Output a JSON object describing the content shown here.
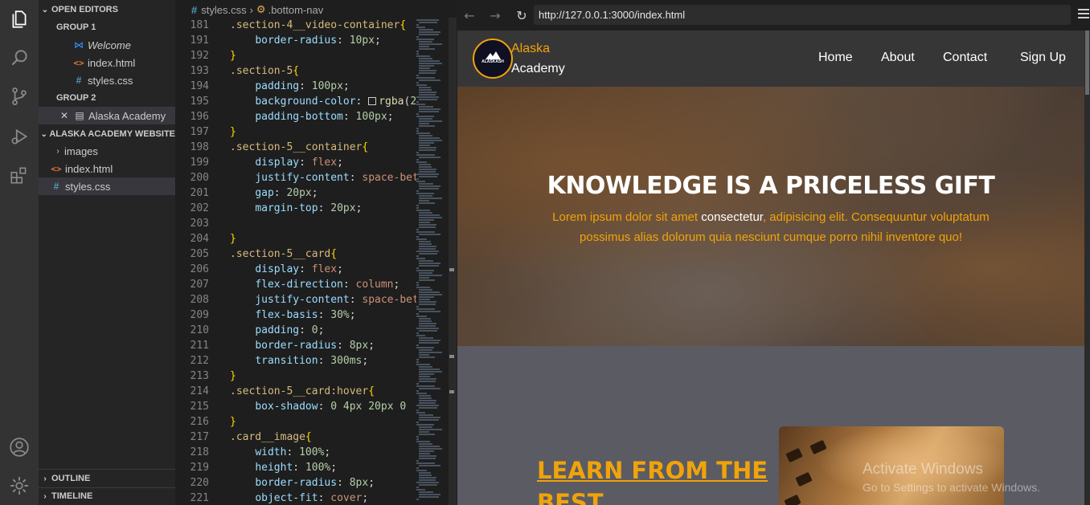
{
  "explorer": {
    "open_editors_title": "OPEN EDITORS",
    "group1_label": "GROUP 1",
    "group1_files": [
      "Welcome",
      "index.html",
      "styles.css"
    ],
    "group2_label": "GROUP 2",
    "group2_files": [
      "Alaska Academy"
    ],
    "workspace_title": "ALASKA ACADEMY WEBSITE",
    "tree": [
      "images",
      "index.html",
      "styles.css"
    ],
    "outline_label": "OUTLINE",
    "timeline_label": "TIMELINE"
  },
  "breadcrumb": {
    "file": "styles.css",
    "symbol": ".bottom-nav"
  },
  "code_lines": [
    {
      "n": "181",
      "t": ".section-4__video-container{"
    },
    {
      "n": "191",
      "t": "    border-radius: 10px;"
    },
    {
      "n": "192",
      "t": "}"
    },
    {
      "n": "193",
      "t": ".section-5{"
    },
    {
      "n": "194",
      "t": "    padding: 100px;"
    },
    {
      "n": "195",
      "t": "    background-color: rgba(2"
    },
    {
      "n": "196",
      "t": "    padding-bottom: 100px;"
    },
    {
      "n": "197",
      "t": "}"
    },
    {
      "n": "198",
      "t": ".section-5__container{"
    },
    {
      "n": "199",
      "t": "    display: flex;"
    },
    {
      "n": "200",
      "t": "    justify-content: space-bet"
    },
    {
      "n": "201",
      "t": "    gap: 20px;"
    },
    {
      "n": "202",
      "t": "    margin-top: 20px;"
    },
    {
      "n": "203",
      "t": ""
    },
    {
      "n": "204",
      "t": "}"
    },
    {
      "n": "205",
      "t": ".section-5__card{"
    },
    {
      "n": "206",
      "t": "    display: flex;"
    },
    {
      "n": "207",
      "t": "    flex-direction: column;"
    },
    {
      "n": "208",
      "t": "    justify-content: space-bet"
    },
    {
      "n": "209",
      "t": "    flex-basis: 30%;"
    },
    {
      "n": "210",
      "t": "    padding: 0;"
    },
    {
      "n": "211",
      "t": "    border-radius: 8px;"
    },
    {
      "n": "212",
      "t": "    transition: 300ms;"
    },
    {
      "n": "213",
      "t": "}"
    },
    {
      "n": "214",
      "t": ".section-5__card:hover{"
    },
    {
      "n": "215",
      "t": "    box-shadow: 0 4px 20px 0"
    },
    {
      "n": "216",
      "t": "}"
    },
    {
      "n": "217",
      "t": ".card__image{"
    },
    {
      "n": "218",
      "t": "    width: 100%;"
    },
    {
      "n": "219",
      "t": "    height: 100%;"
    },
    {
      "n": "220",
      "t": "    border-radius: 8px;"
    },
    {
      "n": "221",
      "t": "    object-fit: cover;"
    }
  ],
  "browser": {
    "url": "http://127.0.0.1:3000/index.html"
  },
  "site": {
    "logo_text": "ALASKASH",
    "brand_line1": "Alaska",
    "brand_line2": "Academy",
    "nav": [
      "Home",
      "About",
      "Contact",
      "Sign Up"
    ],
    "hero_title": "KNOWLEDGE IS A PRICELESS GIFT",
    "hero_body_1": "Lorem ipsum dolor sit amet ",
    "hero_body_hl": "consectetur",
    "hero_body_2": ", adipisicing elit. Consequuntur voluptatum possimus alias dolorum quia nesciunt cumque porro nihil inventore quo!",
    "section_heading": "LEARN FROM THE BEST",
    "accent_color": "#f0a30a"
  },
  "watermark": {
    "line1": "Activate Windows",
    "line2": "Go to Settings to activate Windows."
  }
}
